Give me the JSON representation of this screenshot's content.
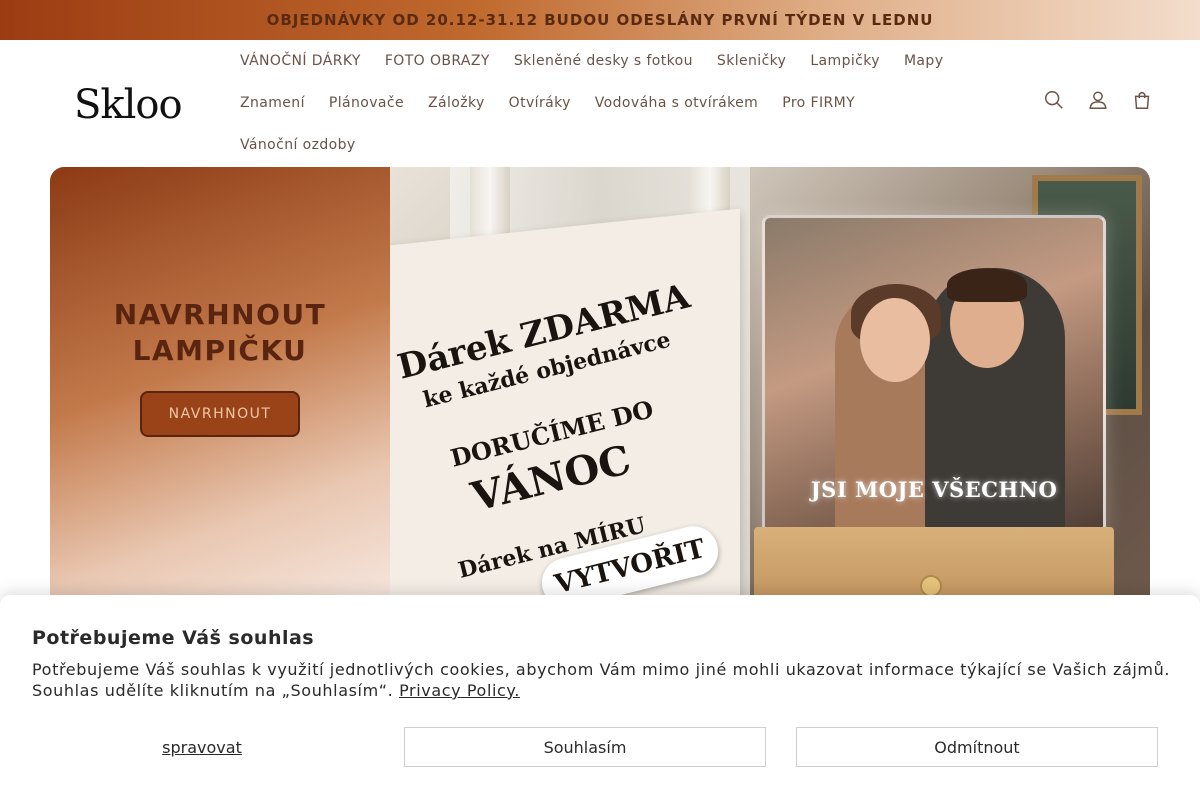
{
  "announcement": "OBJEDNÁVKY OD 20.12-31.12 BUDOU ODESLÁNY PRVNÍ TÝDEN V LEDNU",
  "logo": "Skloo",
  "nav": {
    "row1": [
      "VÁNOČNÍ DÁRKY",
      "FOTO OBRAZY",
      "Skleněné desky s fotkou",
      "Skleničky",
      "Lampičky",
      "Mapy"
    ],
    "row2": [
      "Znamení",
      "Plánovače",
      "Záložky",
      "Otvíráky",
      "Vodováha s otvírákem",
      "Pro FIRMY"
    ],
    "row3": [
      "Vánoční ozdoby"
    ]
  },
  "header_icons": [
    "search-icon",
    "account-icon",
    "cart-icon"
  ],
  "hero": {
    "title": "NAVRHNOUT LAMPIČKU",
    "button": "NAVRHNOUT",
    "promo": {
      "line1": "Dárek ZDARMA",
      "line2": "ke každé objednávce",
      "line3": "DORUČÍME DO",
      "line4": "VÁNOC",
      "line5": "Dárek na MÍRU",
      "cta": "VYTVOŘIT"
    },
    "glass_caption": "JSI MOJE VŠECHNO"
  },
  "consent": {
    "title": "Potřebujeme Váš souhlas",
    "text": "Potřebujeme Váš souhlas k využití jednotlivých cookies, abychom Vám mimo jiné mohli ukazovat informace týkající se Vašich zájmů. Souhlas udělíte kliknutím na „Souhlasím“.",
    "link": "Privacy Policy.",
    "manage": "spravovat",
    "agree": "Souhlasím",
    "reject": "Odmítnout"
  }
}
